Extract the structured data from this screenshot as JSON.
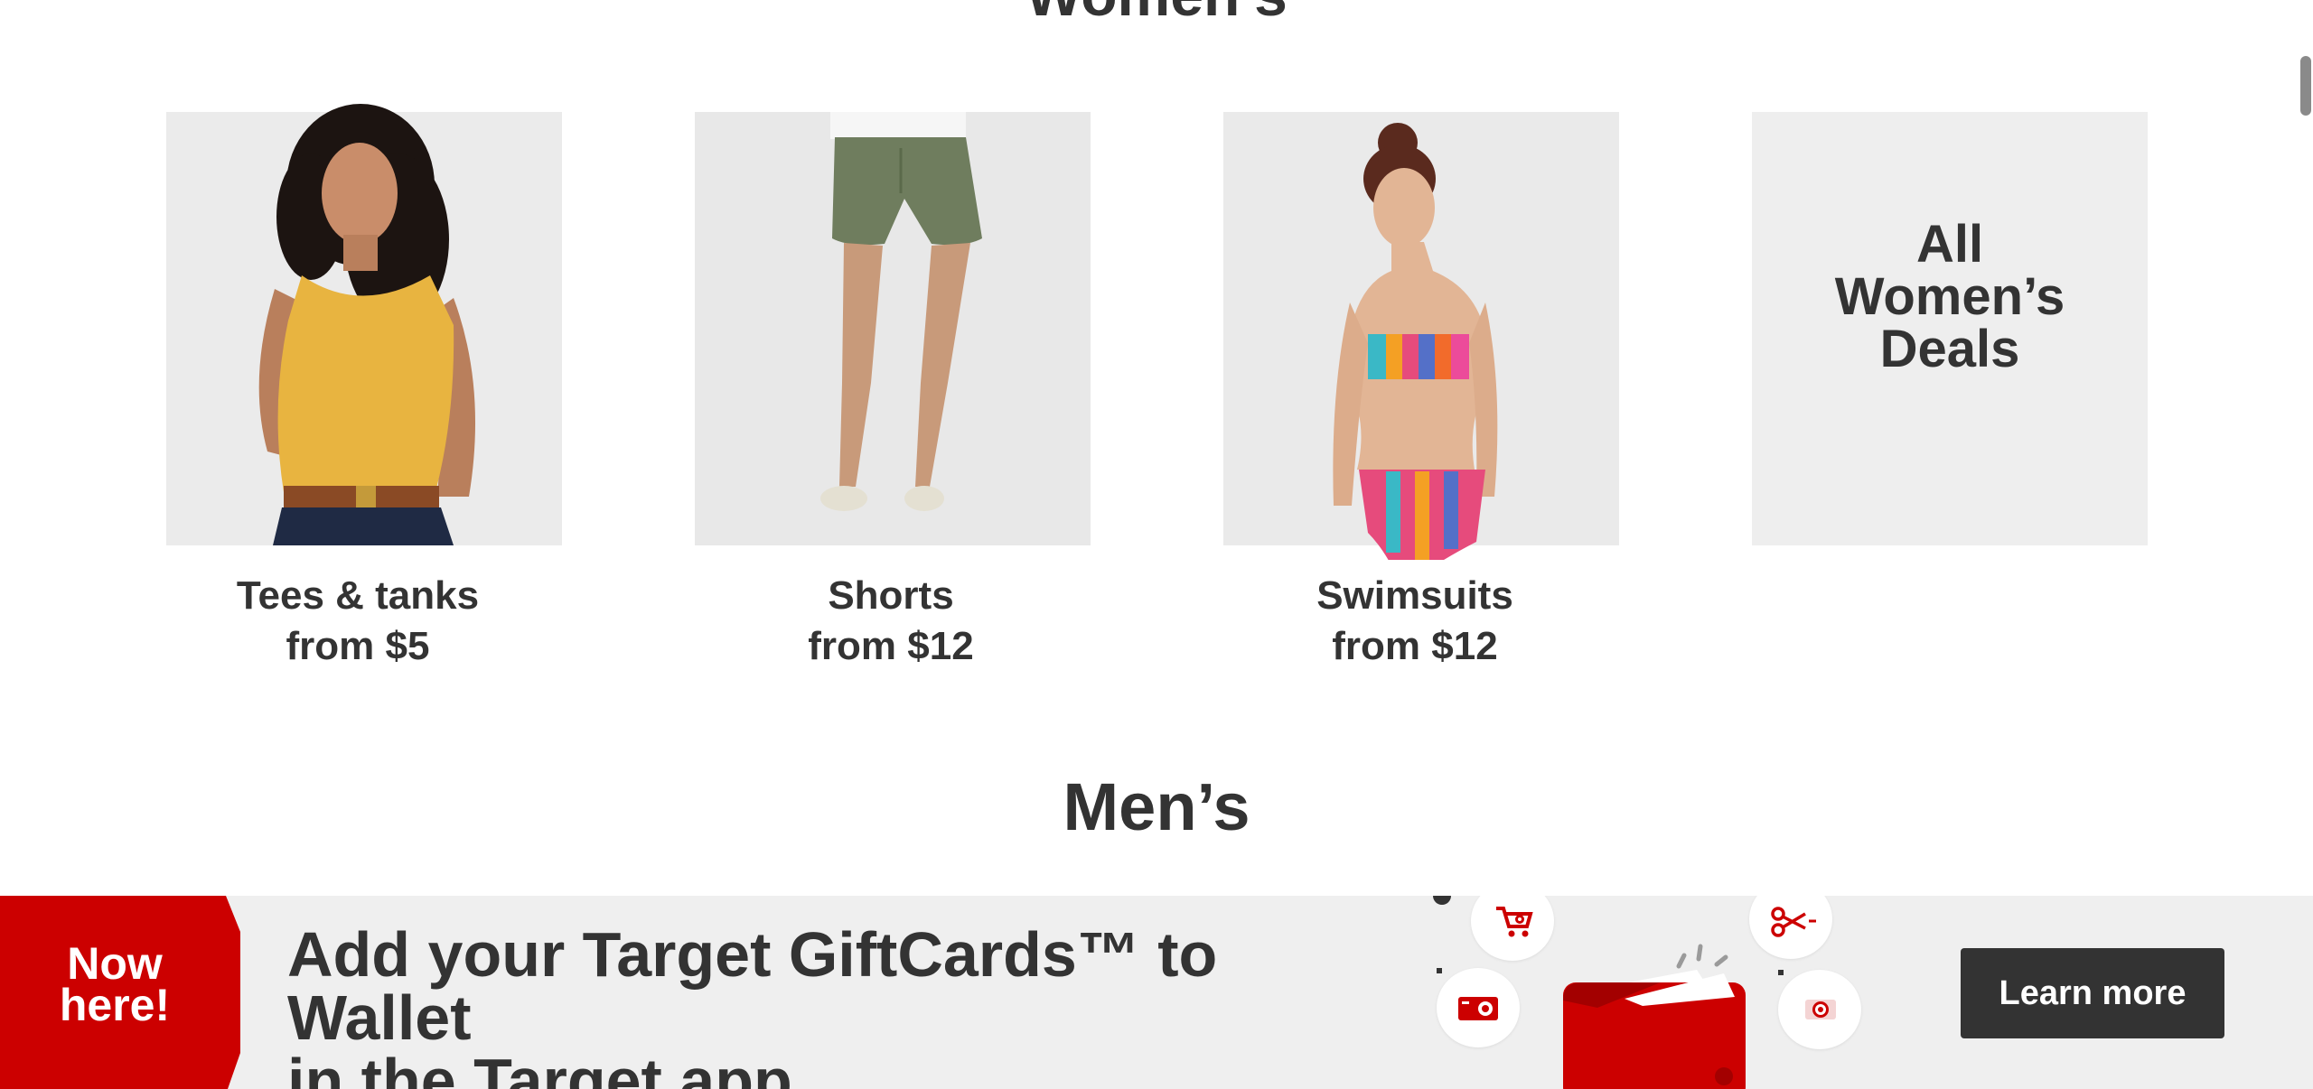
{
  "sections": {
    "women_heading": "Women’s",
    "mens_heading": "Men’s"
  },
  "tiles": [
    {
      "name": "Tees & tanks",
      "price": "from $5"
    },
    {
      "name": "Shorts",
      "price": "from $12"
    },
    {
      "name": "Swimsuits",
      "price": "from $12"
    },
    {
      "lines": [
        "All",
        "Women’s",
        "Deals"
      ]
    }
  ],
  "banner": {
    "badge_lines": [
      "Now",
      "here!"
    ],
    "headline_lines": [
      "Add your Target GiftCards™ to Wallet",
      "in the Target app"
    ],
    "cta_label": "Learn more"
  },
  "icons": {
    "cart": "shopping-cart-icon",
    "scissors": "scissors-icon",
    "card": "gift-card-icon",
    "target": "target-logo-icon",
    "wallet": "wallet-icon"
  },
  "colors": {
    "brand_red": "#cc0000",
    "text_dark": "#333333",
    "tile_bg": "#efefef",
    "button_bg": "#333333"
  }
}
